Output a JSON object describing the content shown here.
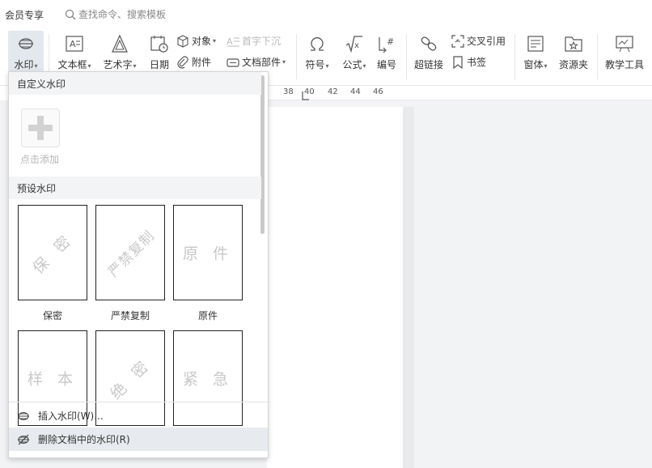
{
  "topbar": {
    "vip_label": "会员专享",
    "search_placeholder": "查找命令、搜索模板"
  },
  "ribbon": {
    "watermark": "水印",
    "textbox": "文本框",
    "wordart": "艺术字",
    "date": "日期",
    "object": "对象",
    "dropcap": "首字下沉",
    "attachment": "附件",
    "docparts": "文档部件",
    "symbol": "符号",
    "formula": "公式",
    "numbering": "编号",
    "hyperlink": "超链接",
    "crossref": "交叉引用",
    "bookmark": "书签",
    "window": "窗体",
    "resources": "资源夹",
    "teaching": "教学工具"
  },
  "ruler": [
    "38",
    "40",
    "42",
    "44",
    "46"
  ],
  "dropdown": {
    "custom_header": "自定义水印",
    "add_label": "点击添加",
    "preset_header": "预设水印",
    "presets": [
      {
        "text": "保 密",
        "caption": "保密"
      },
      {
        "text": "严禁复制",
        "caption": "严禁复制"
      },
      {
        "text": "原 件",
        "caption": "原件"
      },
      {
        "text": "样 本",
        "caption": ""
      },
      {
        "text": "绝 密",
        "caption": ""
      },
      {
        "text": "紧 急",
        "caption": ""
      }
    ],
    "insert_label": "插入水印(W)...",
    "remove_label": "删除文档中的水印(R)"
  },
  "colors": {
    "accent_hover": "#e7eaee",
    "button_active": "#e3e8ee"
  }
}
